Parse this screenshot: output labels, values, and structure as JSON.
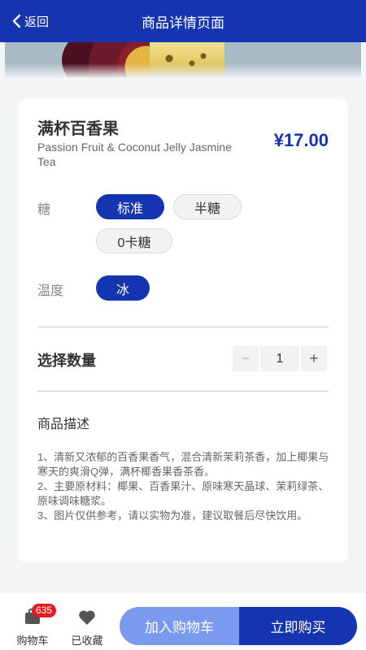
{
  "navbar": {
    "back_label": "返回",
    "title": "商品详情页面"
  },
  "product": {
    "name": "满杯百香果",
    "english_name": "Passion Fruit & Coconut Jelly Jasmine Tea",
    "price": "¥17.00"
  },
  "options": {
    "sugar": {
      "label": "糖",
      "choices": [
        "标准",
        "半糖",
        "0卡糖"
      ],
      "selected": "标准"
    },
    "temperature": {
      "label": "温度",
      "choices": [
        "冰"
      ],
      "selected": "冰"
    }
  },
  "quantity": {
    "label": "选择数量",
    "minus": "−",
    "value": "1",
    "plus": "+"
  },
  "description": {
    "title": "商品描述",
    "lines": [
      "1、清新又浓郁的百香果香气，混合清新茉莉茶香，加上椰果与寒天的爽滑Q弹，满杯椰香果香茶香。",
      "2、主要原材料：椰果、百香果汁、原味寒天晶球、茉莉绿茶、原味调味糖浆。",
      "3、图片仅供参考，请以实物为准，建议取餐后尽快饮用。"
    ]
  },
  "bottom_bar": {
    "cart_label": "购物车",
    "cart_badge": "635",
    "favorite_label": "已收藏",
    "add_to_cart": "加入购物车",
    "buy_now": "立即购买"
  },
  "colors": {
    "primary": "#1434b0",
    "secondary_button": "#7a9af0",
    "badge": "#e41c1c",
    "background": "#f4f5f7"
  },
  "icons": {
    "back": "chevron-left-icon",
    "cart": "cart-icon",
    "favorite": "heart-icon"
  }
}
